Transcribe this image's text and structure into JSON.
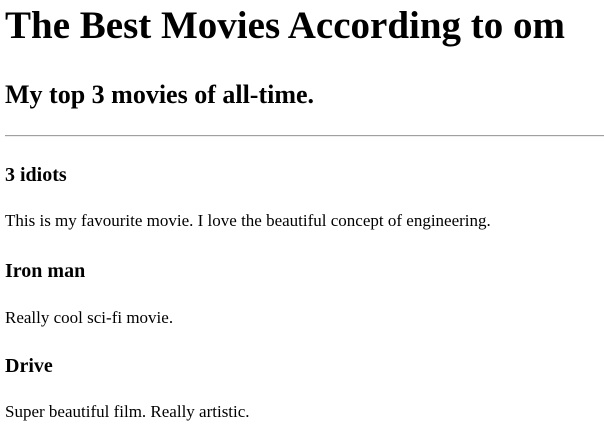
{
  "header": {
    "title": "The Best Movies According to om",
    "subtitle": "My top 3 movies of all-time."
  },
  "movies": [
    {
      "title": "3 idiots",
      "description": "This is my favourite movie. I love the beautiful concept of engineering."
    },
    {
      "title": "Iron man",
      "description": "Really cool sci-fi movie."
    },
    {
      "title": "Drive",
      "description": "Super beautiful film. Really artistic."
    }
  ]
}
